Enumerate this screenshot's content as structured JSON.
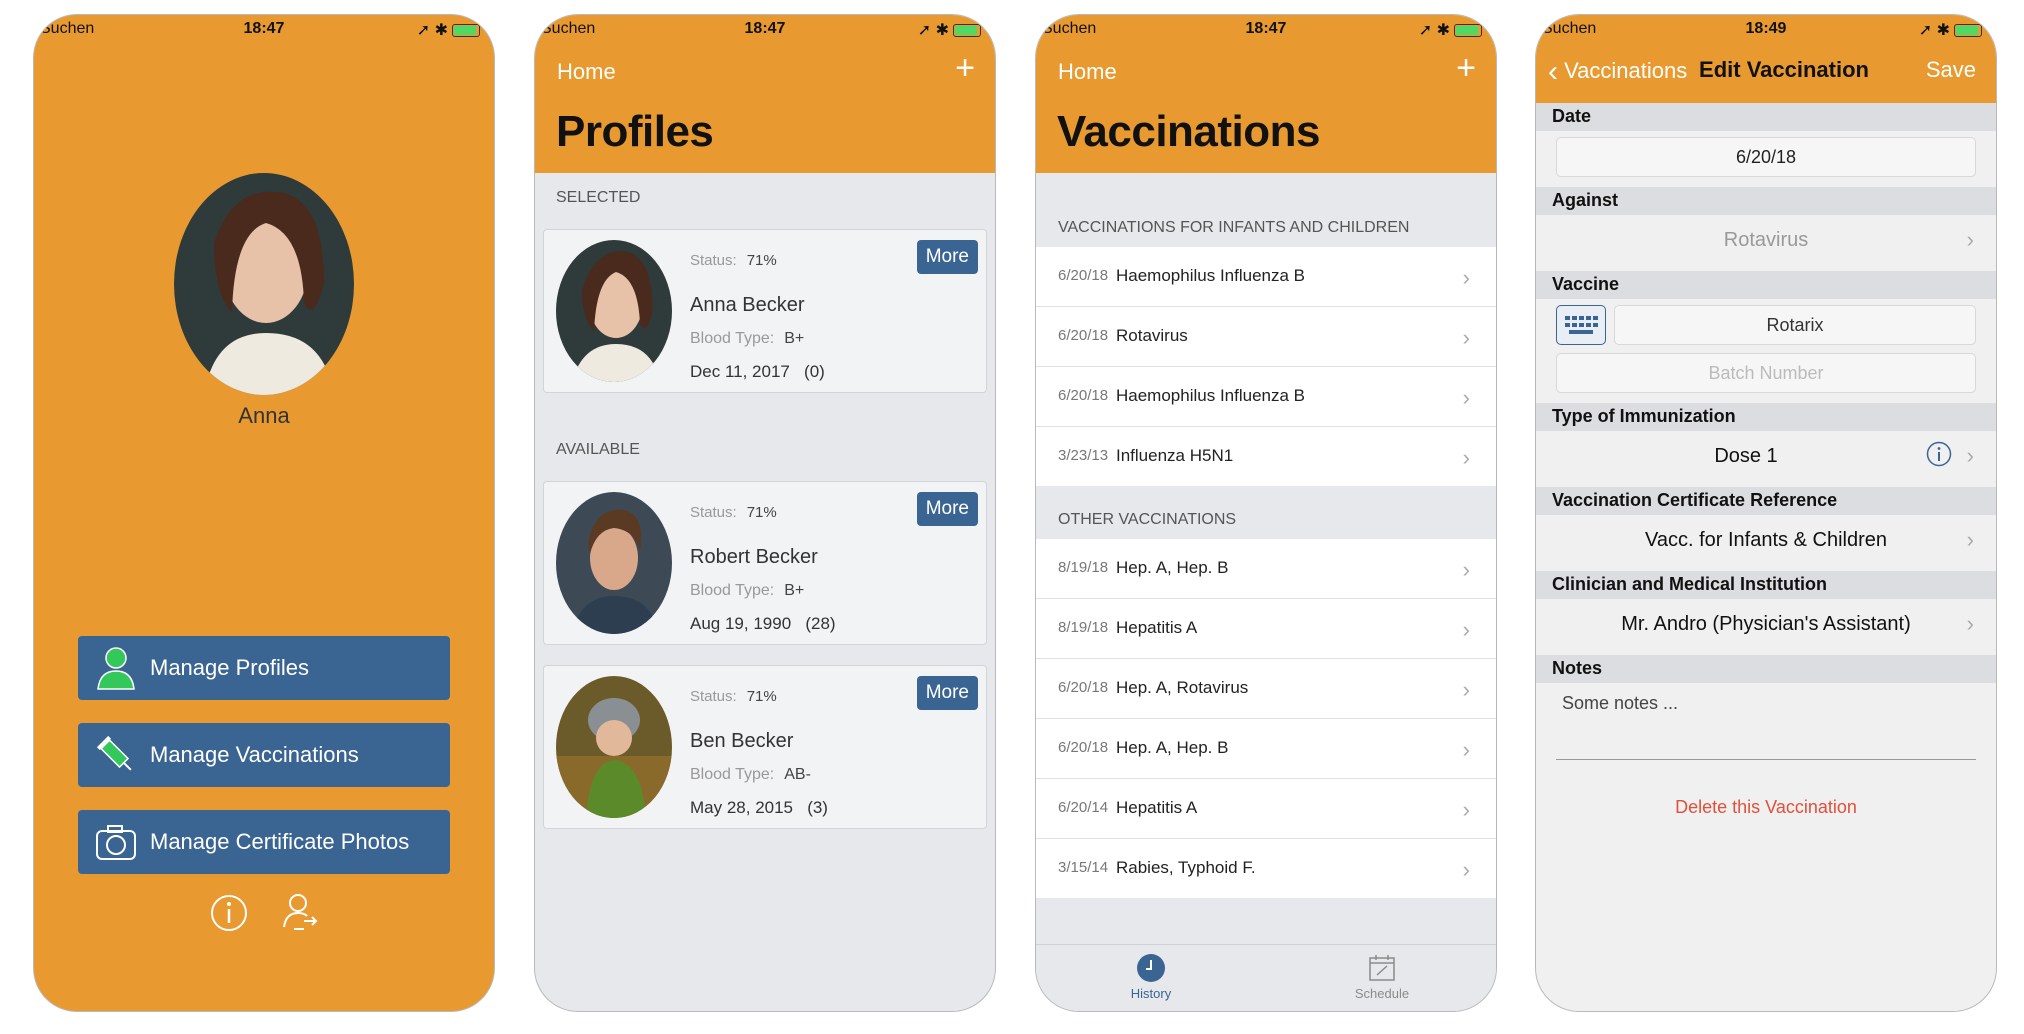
{
  "status_bars": [
    {
      "carrier": "Suchen",
      "time": "18:47"
    },
    {
      "carrier": "Suchen",
      "time": "18:47"
    },
    {
      "carrier": "Suchen",
      "time": "18:47"
    },
    {
      "carrier": "Suchen",
      "time": "18:49"
    }
  ],
  "screen1": {
    "profile_name": "Anna",
    "menu": [
      {
        "label": "Manage Profiles",
        "icon": "person-icon"
      },
      {
        "label": "Manage Vaccinations",
        "icon": "syringe-icon"
      },
      {
        "label": "Manage Certificate Photos",
        "icon": "camera-icon"
      }
    ],
    "bottom_icons": [
      "info-icon",
      "profile-switch-icon"
    ]
  },
  "screen2": {
    "nav_left": "Home",
    "title": "Profiles",
    "selected_header": "SELECTED",
    "available_header": "AVAILABLE",
    "status_label": "Status:",
    "blood_label": "Blood Type:",
    "more_label": "More",
    "selected": [
      {
        "status": "71%",
        "name": "Anna Becker",
        "blood": "B+",
        "dob": "Dec 11, 2017",
        "age": "(0)"
      }
    ],
    "available": [
      {
        "status": "71%",
        "name": "Robert Becker",
        "blood": "B+",
        "dob": "Aug 19, 1990",
        "age": "(28)"
      },
      {
        "status": "71%",
        "name": "Ben Becker",
        "blood": "AB-",
        "dob": "May 28, 2015",
        "age": "(3)"
      }
    ]
  },
  "screen3": {
    "nav_left": "Home",
    "title": "Vaccinations",
    "section1": "VACCINATIONS FOR INFANTS AND CHILDREN",
    "section1_rows": [
      {
        "date": "6/20/18",
        "name": "Haemophilus Influenza B"
      },
      {
        "date": "6/20/18",
        "name": "Rotavirus"
      },
      {
        "date": "6/20/18",
        "name": "Haemophilus Influenza B"
      },
      {
        "date": "3/23/13",
        "name": "Influenza H5N1"
      }
    ],
    "section2": "OTHER VACCINATIONS",
    "section2_rows": [
      {
        "date": "8/19/18",
        "name": "Hep. A, Hep. B"
      },
      {
        "date": "8/19/18",
        "name": "Hepatitis A"
      },
      {
        "date": "6/20/18",
        "name": "Hep. A, Rotavirus"
      },
      {
        "date": "6/20/18",
        "name": "Hep. A, Hep. B"
      },
      {
        "date": "6/20/14",
        "name": "Hepatitis A"
      },
      {
        "date": "3/15/14",
        "name": "Rabies, Typhoid F."
      }
    ],
    "tabs": [
      {
        "label": "History",
        "active": true
      },
      {
        "label": "Schedule",
        "active": false
      }
    ]
  },
  "screen4": {
    "back_label": "Vaccinations",
    "title": "Edit Vaccination",
    "save_label": "Save",
    "date_header": "Date",
    "date_value": "6/20/18",
    "against_header": "Against",
    "against_value": "Rotavirus",
    "vaccine_header": "Vaccine",
    "vaccine_value": "Rotarix",
    "batch_placeholder": "Batch Number",
    "immunization_header": "Type of Immunization",
    "immunization_value": "Dose 1",
    "certificate_header": "Vaccination Certificate Reference",
    "certificate_value": "Vacc. for Infants & Children",
    "clinician_header": "Clinician and Medical Institution",
    "clinician_value": "Mr. Andro (Physician's Assistant)",
    "notes_header": "Notes",
    "notes_value": "Some notes ...",
    "delete_label": "Delete this Vaccination"
  },
  "colors": {
    "accent": "#e89a30",
    "button": "#3a6593",
    "delete": "#e0503a",
    "info": "#3a6593"
  }
}
